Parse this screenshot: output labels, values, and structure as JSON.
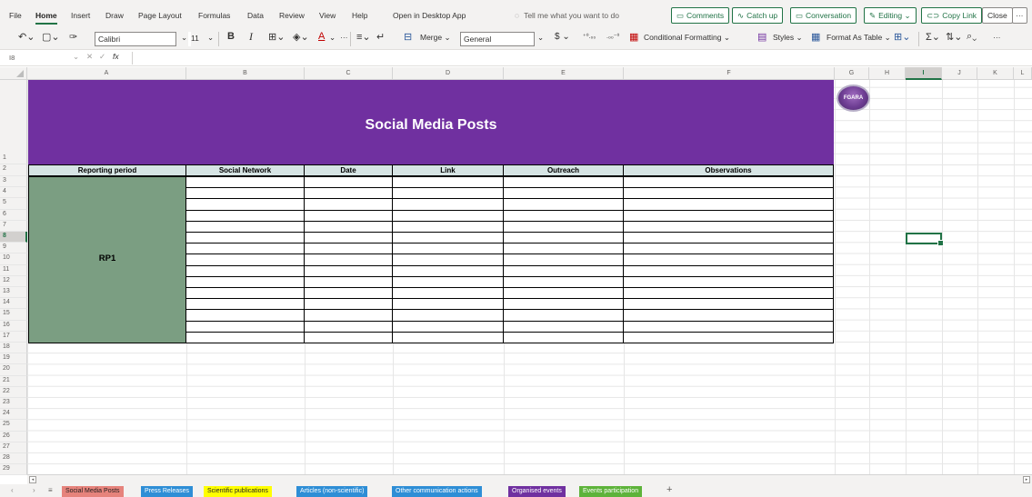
{
  "menu": {
    "tabs": [
      "File",
      "Home",
      "Insert",
      "Draw",
      "Page Layout",
      "Formulas",
      "Data",
      "Review",
      "View",
      "Help",
      "Open in Desktop App"
    ],
    "tell_me": "Tell me what you want to do",
    "buttons": {
      "comments": "Comments",
      "catch_up": "Catch up",
      "conversation": "Conversation",
      "editing": "Editing",
      "copy_link": "Copy Link",
      "close": "Close",
      "more": "···"
    }
  },
  "toolbar": {
    "font_name": "Calibri",
    "font_size": "11",
    "bold": "B",
    "italic": "I",
    "merge": "Merge",
    "number_format": "General",
    "currency": "$",
    "conditional_formatting": "Conditional Formatting",
    "styles": "Styles",
    "format_as_table": "Format As Table",
    "more": "···"
  },
  "formula_bar": {
    "name_box": "I8",
    "cancel": "✕",
    "enter": "✓",
    "fx": "fx",
    "value": ""
  },
  "grid": {
    "columns": [
      "A",
      "B",
      "C",
      "D",
      "E",
      "F",
      "G",
      "H",
      "I",
      "J",
      "K",
      "L"
    ],
    "selected_column": "I",
    "rows": [
      "1",
      "2",
      "3",
      "4",
      "5",
      "6",
      "7",
      "8",
      "9",
      "10",
      "11",
      "12",
      "13",
      "14",
      "15",
      "16",
      "17",
      "18",
      "19",
      "20",
      "21",
      "22",
      "23",
      "24",
      "25",
      "26",
      "27",
      "28",
      "29"
    ],
    "selected_row": "8"
  },
  "sheet": {
    "title": "Social Media Posts",
    "headers": [
      "Reporting period",
      "Social Network",
      "Date",
      "Link",
      "Outreach",
      "Observations"
    ],
    "reporting_period": "RP1",
    "logo_text": "FGARA"
  },
  "colors": {
    "accent": "#217346",
    "banner": "#7030a0",
    "header_fill": "#d6e4e4",
    "rp_fill": "#7b9e82"
  },
  "sheet_tabs": [
    {
      "label": "Social Media Posts",
      "bg": "#e6837c",
      "fg": "#201f1e"
    },
    {
      "label": "Press Releases",
      "bg": "#2e8ed6",
      "fg": "#ffffff"
    },
    {
      "label": "Scientific publications",
      "bg": "#ffff00",
      "fg": "#201f1e"
    },
    {
      "label": "Articles (non-scientific)",
      "bg": "#2e8ed6",
      "fg": "#ffffff"
    },
    {
      "label": "Other communication actions",
      "bg": "#2e8ed6",
      "fg": "#ffffff"
    },
    {
      "label": "Organised events",
      "bg": "#7030a0",
      "fg": "#ffffff"
    },
    {
      "label": "Events participation",
      "bg": "#5db33a",
      "fg": "#ffffff"
    }
  ],
  "tab_nav": {
    "prev": "‹",
    "next": "›",
    "menu": "≡",
    "add": "+"
  }
}
